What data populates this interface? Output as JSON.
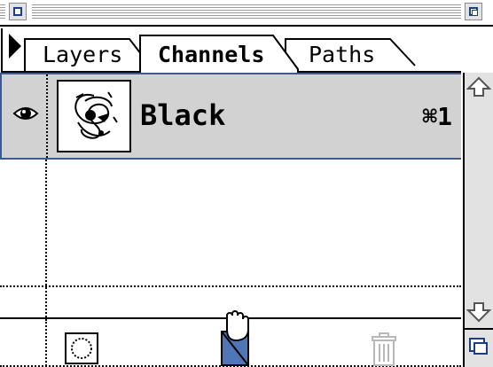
{
  "palette": {
    "tabs": [
      {
        "label": "Layers",
        "active": false
      },
      {
        "label": "Channels",
        "active": true
      },
      {
        "label": "Paths",
        "active": false
      }
    ],
    "channels": [
      {
        "name": "Black",
        "shortcut": "⌘1",
        "visible": true,
        "selected": true
      }
    ],
    "icons": {
      "close": "close-box-icon",
      "zoom": "zoom-box-icon",
      "menu": "palette-menu-arrow-icon",
      "eye": "eye-icon",
      "load_selection": "dotted-circle-selection-icon",
      "new_channel": "new-channel-page-icon",
      "delete": "trash-can-icon",
      "scroll_up": "up-arrow-icon",
      "scroll_down": "down-arrow-icon",
      "grow": "grow-box-icon"
    },
    "colors": {
      "selected_row": "#d2d2d2",
      "selection_border": "#3a5a90",
      "accent_blue": "#1c3e88",
      "scrollbar": "#e2e2e2"
    }
  }
}
